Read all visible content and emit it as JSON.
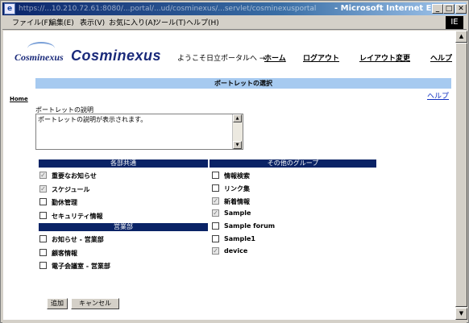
{
  "window": {
    "url": "https://...10.210.72.61:8080/...portal/...ud/cosminexus/...servlet/cosminexusportal",
    "app_title": "- Microsoft Internet Explorer",
    "ie_logo": "IE"
  },
  "menubar": [
    "ファイル(F)",
    "編集(E)",
    "表示(V)",
    "お気に入り(A)",
    "ツール(T)",
    "ヘルプ(H)"
  ],
  "header": {
    "logo_small": "Cosminexus",
    "logo_big": "Cosminexus",
    "welcome": "ようこそ日立ポータルへ →",
    "nav": [
      "ホーム",
      "ログアウト",
      "レイアウト変更",
      "ヘルプ"
    ]
  },
  "sidebar": {
    "home_link": "Home"
  },
  "portlet_select": {
    "title": "ポートレットの選択",
    "help_link": "ヘルプ",
    "description_label": "ポートレットの説明",
    "description_text": "ポートレットの説明が表示されます。"
  },
  "groups": {
    "common": {
      "title": "各部共通",
      "items": [
        {
          "label": "重要なお知らせ",
          "checked": true
        },
        {
          "label": "スケジュール",
          "checked": true
        },
        {
          "label": "勤休管理",
          "checked": false
        },
        {
          "label": "セキュリティ情報",
          "checked": false
        }
      ]
    },
    "sales": {
      "title": "営業部",
      "items": [
        {
          "label": "お知らせ - 営業部",
          "checked": false
        },
        {
          "label": "顧客情報",
          "checked": false
        },
        {
          "label": "電子会議室 - 営業部",
          "checked": false
        }
      ]
    },
    "other": {
      "title": "その他のグループ",
      "items": [
        {
          "label": "情報検索",
          "checked": false
        },
        {
          "label": "リンク集",
          "checked": false
        },
        {
          "label": "新着情報",
          "checked": true
        },
        {
          "label": "Sample",
          "checked": true
        },
        {
          "label": "Sample forum",
          "checked": false
        },
        {
          "label": "Sample1",
          "checked": false
        },
        {
          "label": "device",
          "checked": true
        }
      ]
    }
  },
  "buttons": {
    "add": "追加",
    "cancel": "キャンセル"
  },
  "glyphs": {
    "check": "✓",
    "close": "✕",
    "maximize": "□",
    "minimize": "_",
    "up_arrow": "▲",
    "down_arrow": "▼"
  }
}
